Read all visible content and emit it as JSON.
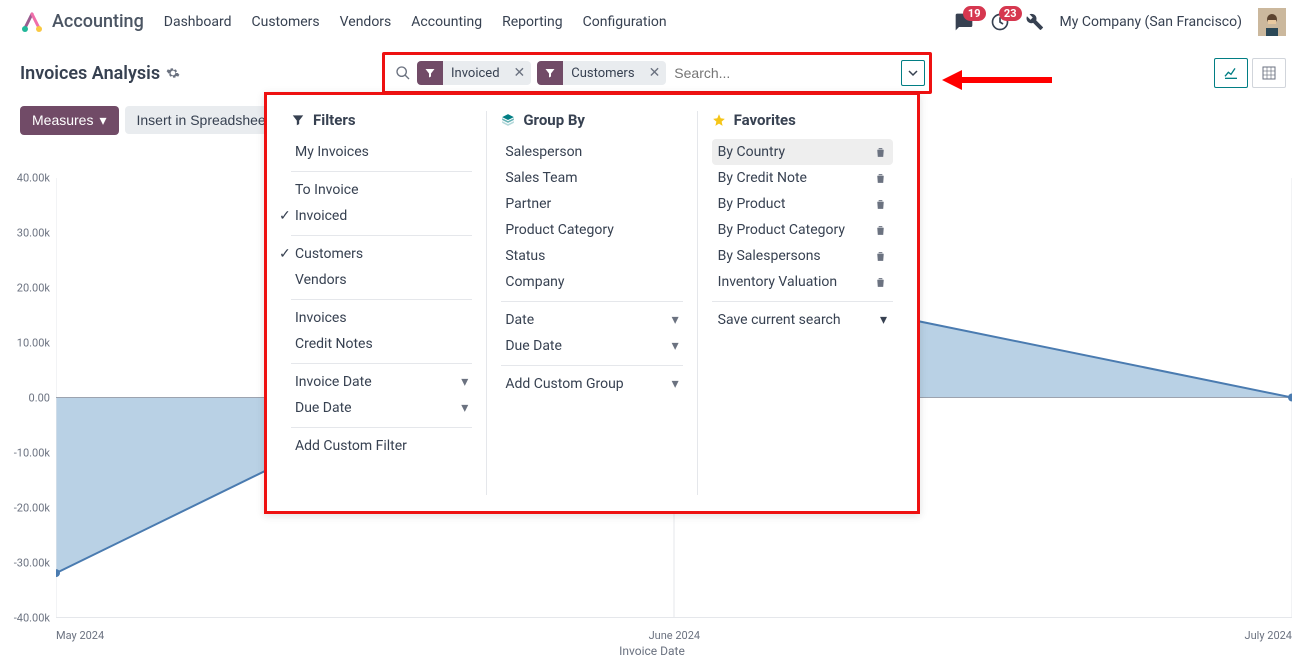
{
  "app_name": "Accounting",
  "nav": [
    "Dashboard",
    "Customers",
    "Vendors",
    "Accounting",
    "Reporting",
    "Configuration"
  ],
  "badge1": "19",
  "badge2": "23",
  "company": "My Company (San Francisco)",
  "page_title": "Invoices Analysis",
  "toolbar": {
    "measures": "Measures",
    "insert": "Insert in Spreadsheet"
  },
  "chips": [
    {
      "label": "Invoiced"
    },
    {
      "label": "Customers"
    }
  ],
  "search_placeholder": "Search...",
  "panel": {
    "filters_title": "Filters",
    "filters": [
      {
        "label": "My Invoices"
      },
      {
        "label": "To Invoice",
        "sep": true
      },
      {
        "label": "Invoiced",
        "checked": true
      },
      {
        "label": "Customers",
        "checked": true,
        "sep": true
      },
      {
        "label": "Vendors"
      },
      {
        "label": "Invoices",
        "sep": true
      },
      {
        "label": "Credit Notes"
      },
      {
        "label": "Invoice Date",
        "caret": true,
        "sep": true
      },
      {
        "label": "Due Date",
        "caret": true
      },
      {
        "label": "Add Custom Filter",
        "sep": true
      }
    ],
    "group_title": "Group By",
    "group": [
      {
        "label": "Salesperson"
      },
      {
        "label": "Sales Team"
      },
      {
        "label": "Partner"
      },
      {
        "label": "Product Category"
      },
      {
        "label": "Status"
      },
      {
        "label": "Company"
      },
      {
        "label": "Date",
        "caret": true,
        "sep": true
      },
      {
        "label": "Due Date",
        "caret": true
      },
      {
        "label": "Add Custom Group",
        "caret": true,
        "sep": true
      }
    ],
    "fav_title": "Favorites",
    "favs": [
      {
        "label": "By Country",
        "hl": true
      },
      {
        "label": "By Credit Note"
      },
      {
        "label": "By Product"
      },
      {
        "label": "By Product Category"
      },
      {
        "label": "By Salespersons"
      },
      {
        "label": "Inventory Valuation"
      }
    ],
    "save_search": "Save current search"
  },
  "chart_data": {
    "type": "area",
    "categories": [
      "May 2024",
      "June 2024",
      "July 2024"
    ],
    "values": [
      -32000,
      23000,
      0
    ],
    "xlabel": "Invoice Date",
    "ylabel": "",
    "yticks": [
      "40.00k",
      "30.00k",
      "20.00k",
      "10.00k",
      "0.00",
      "-10.00k",
      "-20.00k",
      "-30.00k",
      "-40.00k"
    ],
    "ylim": [
      -40000,
      40000
    ]
  }
}
